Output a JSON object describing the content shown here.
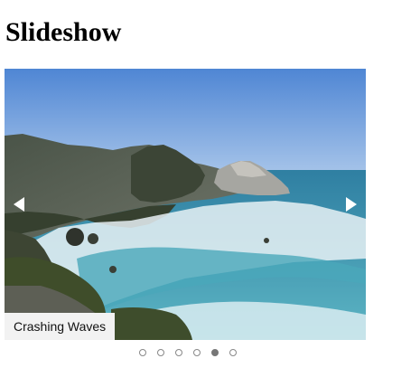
{
  "page": {
    "title": "Slideshow"
  },
  "slideshow": {
    "caption": "Crashing Waves",
    "slide_count": 6,
    "active_index": 4,
    "colors": {
      "sky": "#5b8fd6",
      "ocean": "#3f9fb3",
      "surf": "#e9f2f5",
      "cliff": "#515a4f",
      "vegetation": "#3b4a2a"
    },
    "icons": {
      "prev": "chevron-left-icon",
      "next": "chevron-right-icon"
    }
  }
}
